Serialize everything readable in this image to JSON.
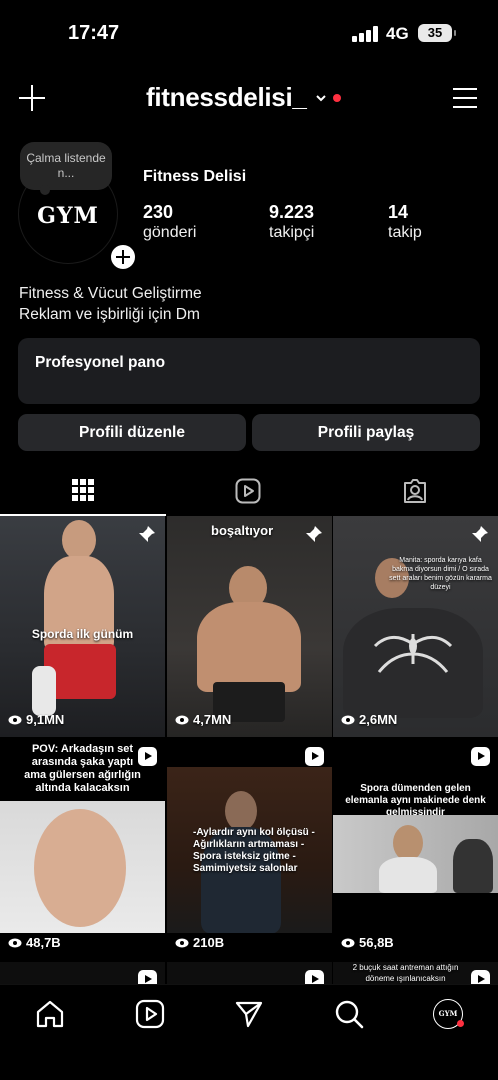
{
  "status_bar": {
    "time": "17:47",
    "network": "4G",
    "battery": "35"
  },
  "header": {
    "username": "fitnessdelisi_"
  },
  "profile": {
    "note": "Çalma listende n...",
    "avatar_text": "GYM",
    "display_name": "Fitness Delisi",
    "stats": [
      {
        "value": "230",
        "label": "gönderi"
      },
      {
        "value": "9.223",
        "label": "takipçi"
      },
      {
        "value": "14",
        "label": "takip"
      }
    ],
    "bio": [
      "Fitness & Vücut Geliştirme",
      "Reklam ve işbirliği için Dm"
    ]
  },
  "pro_dashboard": {
    "label": "Profesyonel pano"
  },
  "actions": {
    "edit": "Profili düzenle",
    "share": "Profili paylaş"
  },
  "tabs": [
    {
      "icon": "grid-icon",
      "active": true
    },
    {
      "icon": "reels-icon",
      "active": false
    },
    {
      "icon": "tagged-icon",
      "active": false
    }
  ],
  "posts": [
    {
      "caption": "Sporda ilk günüm",
      "views": "9,1MN",
      "pinned": true
    },
    {
      "caption": "boşaltıyor",
      "views": "4,7MN",
      "pinned": true
    },
    {
      "caption": "Manita: sporda karıya kafa bakma diyorsun dimi / O sırada sett araları benim gözün kararma düzeyi",
      "views": "2,6MN",
      "pinned": true
    },
    {
      "caption": "POV: Arkadaşın set arasında şaka yaptı ama gülersen ağırlığın altında kalacaksın",
      "views": "48,7B",
      "reel": true
    },
    {
      "caption": "-Aylardır aynı kol ölçüsü -Ağırlıkların artmaması -Spora isteksiz gitme -Samimiyetsiz salonlar",
      "views": "210B",
      "reel": true
    },
    {
      "caption": "Spora dümenden gelen elemanla aynı makinede denk gelmişsindir",
      "views": "56,8B",
      "reel": true
    },
    {
      "caption": "",
      "views": "",
      "reel": true
    },
    {
      "caption": "",
      "views": "",
      "reel": true
    },
    {
      "caption": "2 buçuk saat antreman attığın döneme ışınlanıcaksın",
      "views": "",
      "reel": true
    }
  ],
  "bottom_nav": {
    "profile_avatar_text": "GYM"
  }
}
